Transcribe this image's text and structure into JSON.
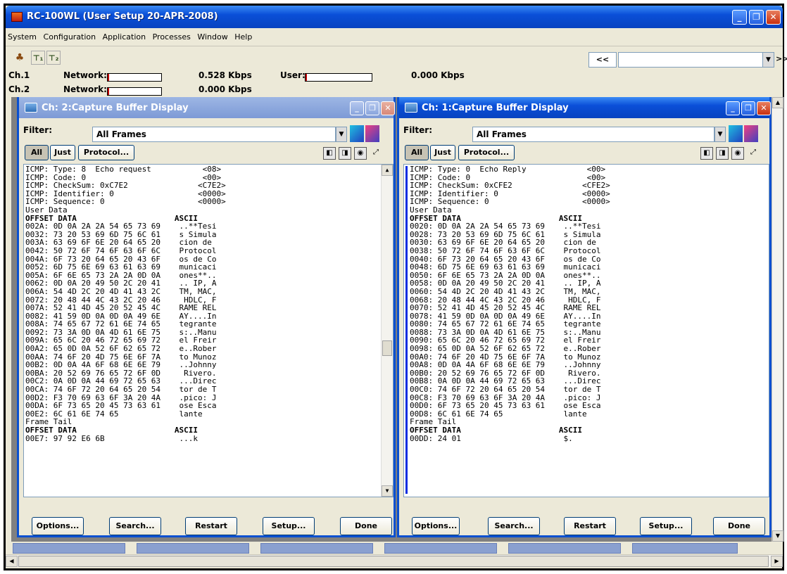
{
  "app": {
    "title": "RC-100WL (User Setup 20-APR-2008)"
  },
  "menu": [
    "System",
    "Configuration",
    "Application",
    "Processes",
    "Window",
    "Help"
  ],
  "toolbar": {
    "prev_label": "<<",
    "next_label": ">>",
    "nav_value": ""
  },
  "status": {
    "ch1": {
      "label": "Ch.1",
      "network_label": "Network:",
      "network_rate": "0.528 Kbps",
      "user_label": "User:",
      "user_rate": "0.000 Kbps",
      "network_level": 0.02,
      "user_level": 0.02
    },
    "ch2": {
      "label": "Ch.2",
      "network_label": "Network:",
      "network_rate": "0.000 Kbps",
      "network_level": 0.02
    }
  },
  "windows": [
    {
      "title": "Ch: 2:Capture Buffer Display",
      "active": false,
      "filter_label": "Filter:",
      "filter_value": "All Frames",
      "btn_all": "All",
      "btn_just": "Just",
      "btn_protocol": "Protocol...",
      "lines": [
        "ICMP: Type: 8  Echo request           <08>",
        "ICMP: Code: 0                         <00>",
        "ICMP: CheckSum: 0xC7E2               <C7E2>",
        "ICMP: Identifier: 0                  <0000>",
        "ICMP: Sequence: 0                    <0000>",
        "User Data",
        "OFFSET DATA                     ASCII",
        "002A: 0D 0A 2A 2A 54 65 73 69    ..**Tesi",
        "0032: 73 20 53 69 6D 75 6C 61    s Simula",
        "003A: 63 69 6F 6E 20 64 65 20    cion de",
        "0042: 50 72 6F 74 6F 63 6F 6C    Protocol",
        "004A: 6F 73 20 64 65 20 43 6F    os de Co",
        "0052: 6D 75 6E 69 63 61 63 69    municaci",
        "005A: 6F 6E 65 73 2A 2A 0D 0A    ones**..",
        "0062: 0D 0A 20 49 50 2C 20 41    .. IP, A",
        "006A: 54 4D 2C 20 4D 41 43 2C    TM, MAC,",
        "0072: 20 48 44 4C 43 2C 20 46     HDLC, F",
        "007A: 52 41 4D 45 20 52 45 4C    RAME REL",
        "0082: 41 59 0D 0A 0D 0A 49 6E    AY....In",
        "008A: 74 65 67 72 61 6E 74 65    tegrante",
        "0092: 73 3A 0D 0A 4D 61 6E 75    s:..Manu",
        "009A: 65 6C 20 46 72 65 69 72    el Freir",
        "00A2: 65 0D 0A 52 6F 62 65 72    e..Rober",
        "00AA: 74 6F 20 4D 75 6E 6F 7A    to Munoz",
        "00B2: 0D 0A 4A 6F 68 6E 6E 79    ..Johnny",
        "00BA: 20 52 69 76 65 72 6F 0D     Rivero.",
        "00C2: 0A 0D 0A 44 69 72 65 63    ...Direc",
        "00CA: 74 6F 72 20 64 65 20 54    tor de T",
        "00D2: F3 70 69 63 6F 3A 20 4A    .pico: J",
        "00DA: 6F 73 65 20 45 73 63 61    ose Esca",
        "00E2: 6C 61 6E 74 65             lante",
        "Frame Tail",
        "OFFSET DATA                     ASCII",
        "00E7: 97 92 E6 6B                ...k"
      ],
      "bold_lines": [
        6,
        32
      ],
      "buttons": {
        "options": "Options...",
        "search": "Search...",
        "restart": "Restart",
        "setup": "Setup...",
        "done": "Done"
      }
    },
    {
      "title": "Ch: 1:Capture Buffer Display",
      "active": true,
      "filter_label": "Filter:",
      "filter_value": "All Frames",
      "btn_all": "All",
      "btn_just": "Just",
      "btn_protocol": "Protocol...",
      "lines": [
        "ICMP: Type: 0  Echo Reply             <00>",
        "ICMP: Code: 0                         <00>",
        "ICMP: CheckSum: 0xCFE2               <CFE2>",
        "ICMP: Identifier: 0                  <0000>",
        "ICMP: Sequence: 0                    <0000>",
        "User Data",
        "OFFSET DATA                     ASCII",
        "0020: 0D 0A 2A 2A 54 65 73 69    ..**Tesi",
        "0028: 73 20 53 69 6D 75 6C 61    s Simula",
        "0030: 63 69 6F 6E 20 64 65 20    cion de",
        "0038: 50 72 6F 74 6F 63 6F 6C    Protocol",
        "0040: 6F 73 20 64 65 20 43 6F    os de Co",
        "0048: 6D 75 6E 69 63 61 63 69    municaci",
        "0050: 6F 6E 65 73 2A 2A 0D 0A    ones**..",
        "0058: 0D 0A 20 49 50 2C 20 41    .. IP, A",
        "0060: 54 4D 2C 20 4D 41 43 2C    TM, MAC,",
        "0068: 20 48 44 4C 43 2C 20 46     HDLC, F",
        "0070: 52 41 4D 45 20 52 45 4C    RAME REL",
        "0078: 41 59 0D 0A 0D 0A 49 6E    AY....In",
        "0080: 74 65 67 72 61 6E 74 65    tegrante",
        "0088: 73 3A 0D 0A 4D 61 6E 75    s:..Manu",
        "0090: 65 6C 20 46 72 65 69 72    el Freir",
        "0098: 65 0D 0A 52 6F 62 65 72    e..Rober",
        "00A0: 74 6F 20 4D 75 6E 6F 7A    to Munoz",
        "00A8: 0D 0A 4A 6F 68 6E 6E 79    ..Johnny",
        "00B0: 20 52 69 76 65 72 6F 0D     Rivero.",
        "00B8: 0A 0D 0A 44 69 72 65 63    ...Direc",
        "00C0: 74 6F 72 20 64 65 20 54    tor de T",
        "00C8: F3 70 69 63 6F 3A 20 4A    .pico: J",
        "00D0: 6F 73 65 20 45 73 63 61    ose Esca",
        "00D8: 6C 61 6E 74 65             lante",
        "Frame Tail",
        "OFFSET DATA                     ASCII",
        "00DD: 24 01                      $."
      ],
      "bold_lines": [
        6,
        32
      ],
      "buttons": {
        "options": "Options...",
        "search": "Search...",
        "restart": "Restart",
        "setup": "Setup...",
        "done": "Done"
      }
    }
  ]
}
